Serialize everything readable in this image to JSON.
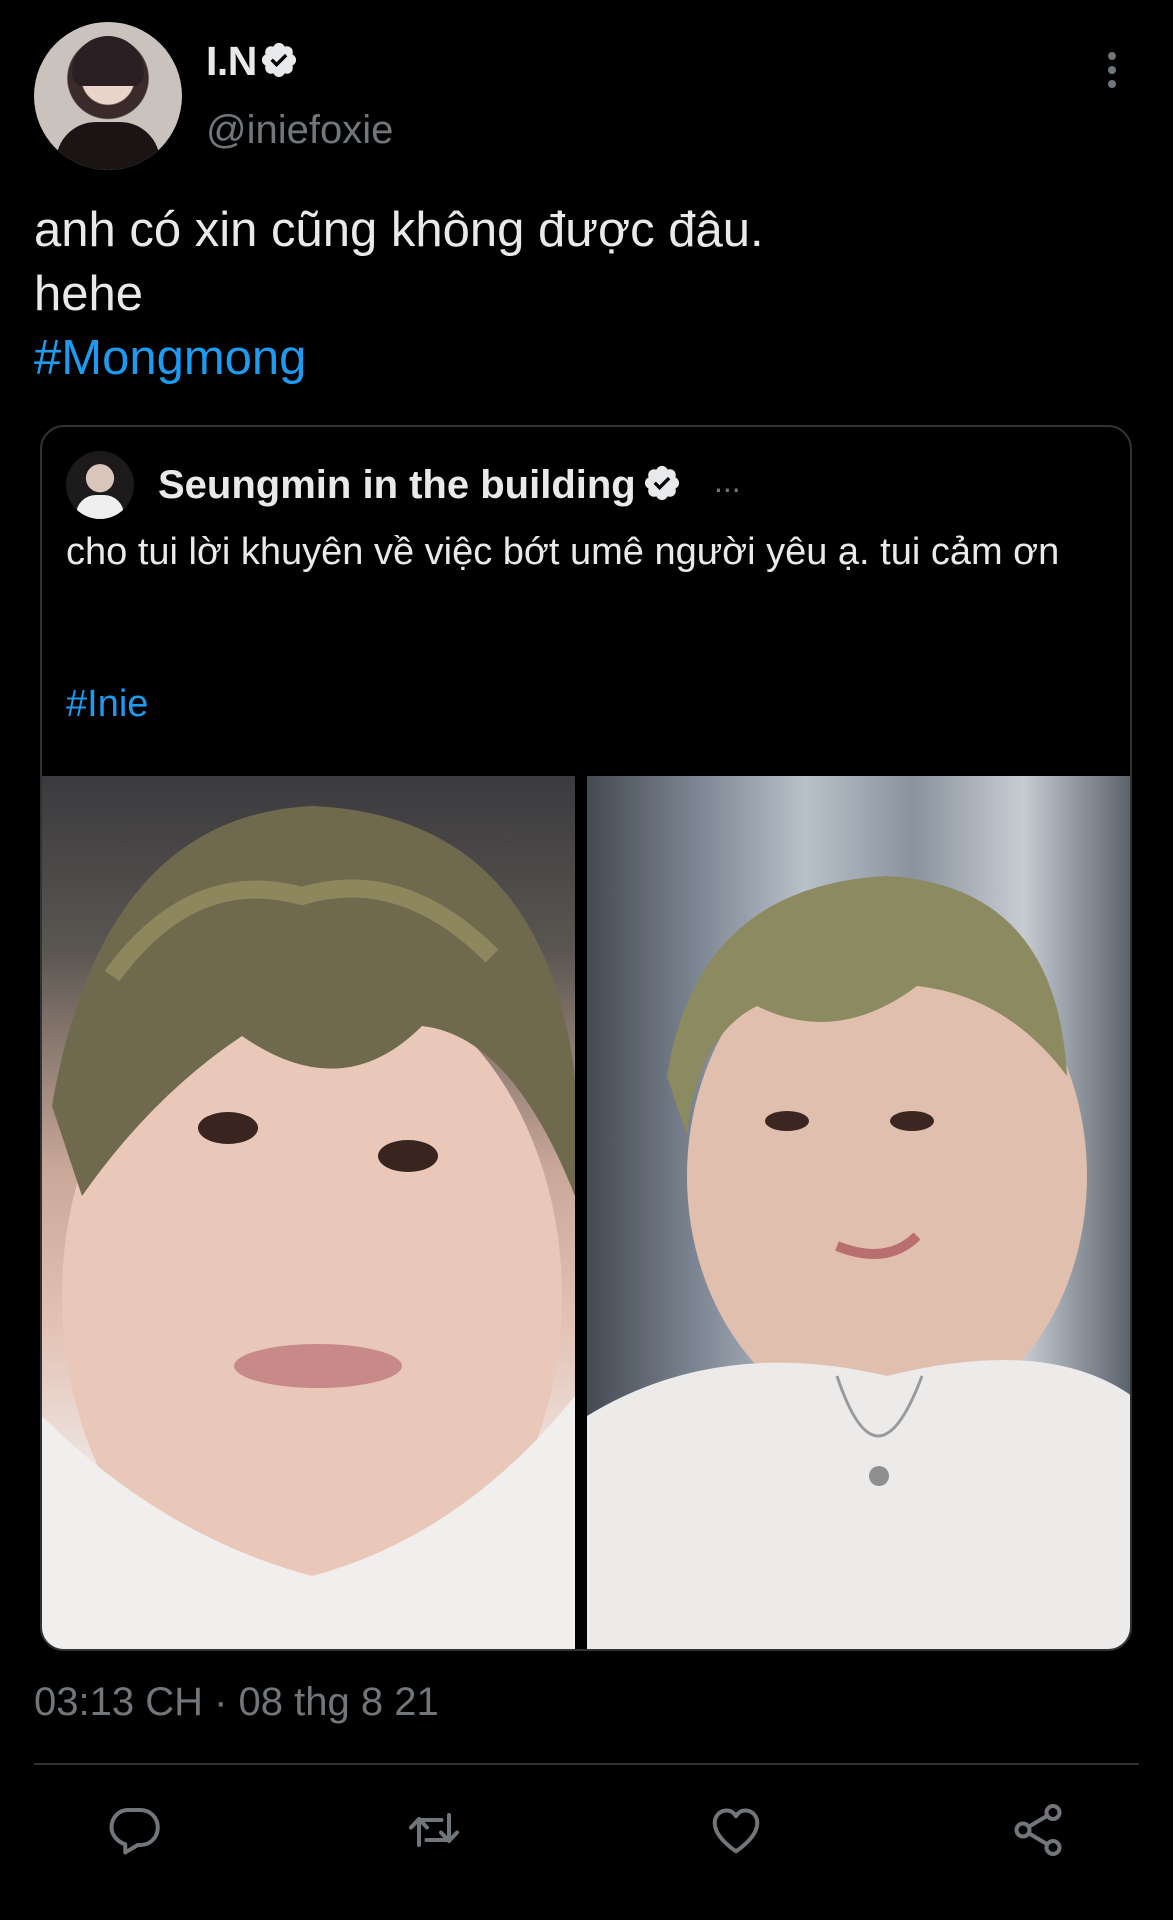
{
  "tweet": {
    "author": {
      "name": "I.N",
      "handle": "@iniefoxie",
      "verified": true
    },
    "text_lines": [
      "anh có xin cũng không được đâu.",
      "hehe"
    ],
    "hashtag": "#Mongmong",
    "timestamp": "03:13 CH · 08 thg 8 21"
  },
  "quote": {
    "author": {
      "name": "Seungmin in the building",
      "verified": true
    },
    "ellipsis": "...",
    "text": "cho tui lời khuyên về việc bớt umê người yêu ạ. tui cảm ơn",
    "hashtag": "#Inie",
    "photos": [
      "photo-left",
      "photo-right"
    ]
  },
  "actions": [
    {
      "name": "reply",
      "icon": "reply-icon"
    },
    {
      "name": "retweet",
      "icon": "retweet-icon"
    },
    {
      "name": "like",
      "icon": "heart-icon"
    },
    {
      "name": "share",
      "icon": "share-icon"
    }
  ],
  "colors": {
    "background": "#000000",
    "text": "#e7e9ea",
    "secondary": "#71767b",
    "accent": "#1d9bf0",
    "border": "#2f3336"
  }
}
